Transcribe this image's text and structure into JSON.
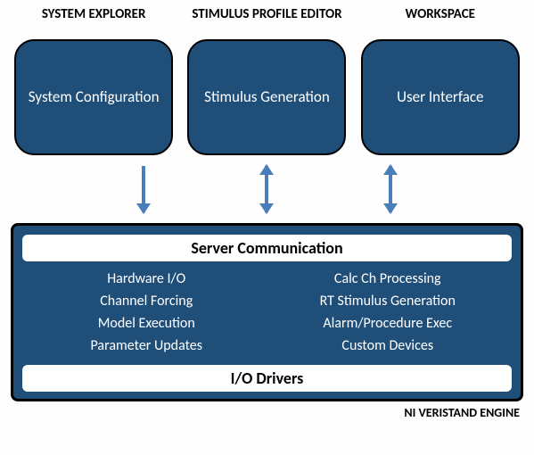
{
  "headings": {
    "h1": "SYSTEM EXPLORER",
    "h2": "STIMULUS PROFILE EDITOR",
    "h3": "WORKSPACE"
  },
  "boxes": {
    "b1": "System Configuration",
    "b2": "Stimulus Generation",
    "b3": "User Interface"
  },
  "engine": {
    "top_band": "Server Communication",
    "left": [
      "Hardware I/O",
      "Channel Forcing",
      "Model  Execution",
      "Parameter Updates"
    ],
    "right": [
      "Calc Ch Processing",
      "RT Stimulus Generation",
      "Alarm/Procedure Exec",
      "Custom Devices"
    ],
    "bottom_band": "I/O Drivers"
  },
  "caption": "NI VERISTAND ENGINE",
  "colors": {
    "fill": "#1f4e79",
    "arrow": "#4a7ebb"
  }
}
